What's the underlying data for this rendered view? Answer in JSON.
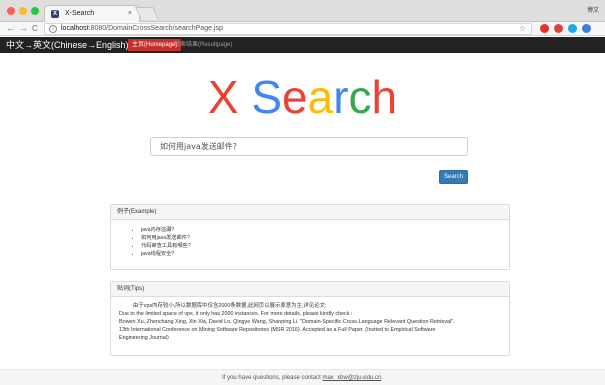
{
  "browser": {
    "tab_title": "X-Search",
    "tab_close": "×",
    "favicon_letter": "X",
    "corner_label": "博文",
    "back": "←",
    "forward": "→",
    "reload": "C",
    "url_host": "localhost",
    "url_rest": ":8080/DomainCrossSearch/searchPage.jsp",
    "star": "☆",
    "extensions": [
      {
        "name": "abp-icon",
        "color": "#e4312b"
      },
      {
        "name": "shield-icon",
        "color": "#e0423a"
      },
      {
        "name": "status-dot-icon",
        "color": "#1aa9f0"
      },
      {
        "name": "home-icon",
        "color": "#3c7fd8"
      }
    ]
  },
  "nav": {
    "brand": "中文→英文(Chinese→English)",
    "active": "主页(Homepage)",
    "link": "检索结果(Resultpage)"
  },
  "logo": {
    "x": "X",
    "s": "S",
    "e": "e",
    "a": "a",
    "r": "r",
    "c": "c",
    "h": "h"
  },
  "search": {
    "value": "如何用java发送邮件?",
    "button": "Search"
  },
  "examples": {
    "heading": "例子(Example)",
    "items": [
      "java内存溢漏?",
      "如何用java发送邮件?",
      "代码审查工具有哪些?",
      "java线程安全?"
    ]
  },
  "tips": {
    "heading": "贴词(Tips)",
    "line1": "由于vps内存较小,所以数据库中仅含2000条数据,此网页以展示原意为主,详见论文:",
    "line2": "Due to the limited space of vps, it only has 2000 instances. For more details, please kindly check :",
    "line3": "Bowen Xu, Zhenchang Xing, Xin Xia, David Lo, Qingye Wang, Shanping Li. \"Domain-Specific Cross-Language Relevant Question Retrieval\".",
    "line4": "13th International Conference on Mining Software Repositories (MSR 2016). Accepted as a Full Paper. (Invited to Empirical Software",
    "line5": "Engineering Journal)"
  },
  "footer": {
    "text": "If you have questions, please contact",
    "email": "max_xbw@zju.edu.cn",
    "tail": "."
  }
}
